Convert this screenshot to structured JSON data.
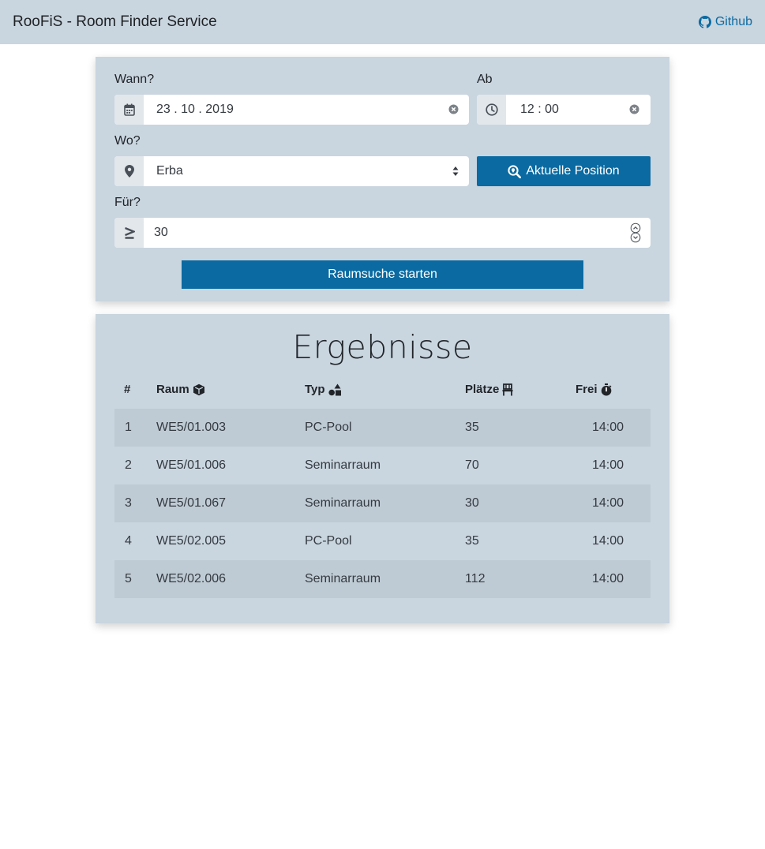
{
  "navbar": {
    "brand": "RooFiS - Room Finder Service",
    "github_label": "Github",
    "github_icon": "github-icon"
  },
  "form": {
    "when_label": "Wann?",
    "date_value": "23 . 10 . 2019",
    "date_icon": "calendar-icon",
    "from_label": "Ab",
    "time_value": "12 : 00",
    "time_icon": "clock-icon",
    "where_label": "Wo?",
    "location_value": "Erba",
    "location_icon": "map-marker-icon",
    "position_button": "Aktuelle Position",
    "for_label": "Für?",
    "seats_value": "30",
    "seats_icon": "greater-equal-icon",
    "search_button": "Raumsuche starten"
  },
  "results": {
    "title": "Ergebnisse",
    "columns": {
      "num": "#",
      "room": "Raum",
      "type": "Typ",
      "seats": "Plätze",
      "free": "Frei"
    },
    "rows": [
      {
        "num": "1",
        "room": "WE5/01.003",
        "type": "PC-Pool",
        "seats": "35",
        "free": "14:00"
      },
      {
        "num": "2",
        "room": "WE5/01.006",
        "type": "Seminarraum",
        "seats": "70",
        "free": "14:00"
      },
      {
        "num": "3",
        "room": "WE5/01.067",
        "type": "Seminarraum",
        "seats": "30",
        "free": "14:00"
      },
      {
        "num": "4",
        "room": "WE5/02.005",
        "type": "PC-Pool",
        "seats": "35",
        "free": "14:00"
      },
      {
        "num": "5",
        "room": "WE5/02.006",
        "type": "Seminarraum",
        "seats": "112",
        "free": "14:00"
      }
    ]
  },
  "colors": {
    "navbar_bg": "#c9d5df",
    "card_bg": "#c9d5df",
    "accent": "#0a6aa1",
    "striped_row": "#bfcbd4"
  }
}
